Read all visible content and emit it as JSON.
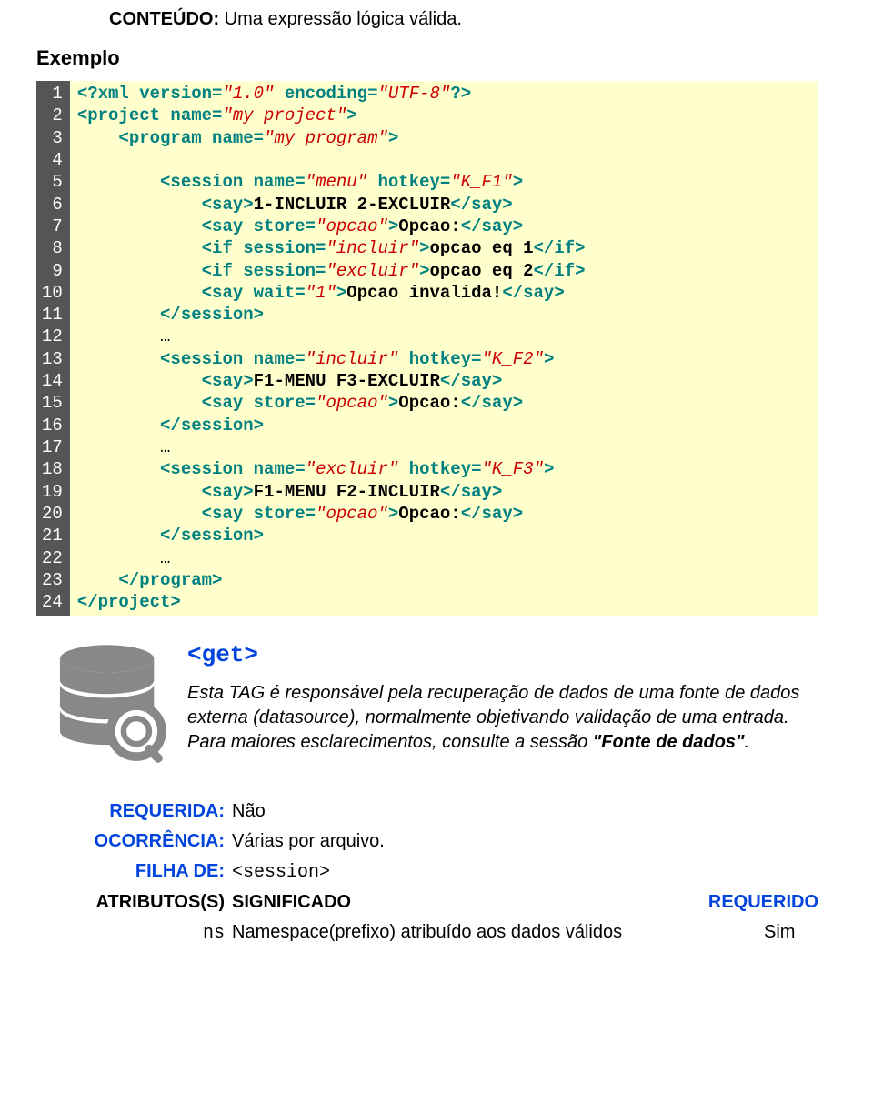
{
  "content": {
    "label": "CONTEÚDO:",
    "text": "Uma expressão lógica válida."
  },
  "example_header": "Exemplo",
  "code": {
    "line_count": 24,
    "lines": [
      [
        {
          "t": "tag",
          "v": "<?xml version="
        },
        {
          "t": "val",
          "v": "\"1.0\""
        },
        {
          "t": "tag",
          "v": " encoding="
        },
        {
          "t": "val",
          "v": "\"UTF-8\""
        },
        {
          "t": "tag",
          "v": "?>"
        }
      ],
      [
        {
          "t": "tag",
          "v": "<project name="
        },
        {
          "t": "val",
          "v": "\"my project\""
        },
        {
          "t": "tag",
          "v": ">"
        }
      ],
      [
        {
          "t": "pad",
          "v": "    "
        },
        {
          "t": "tag",
          "v": "<program name="
        },
        {
          "t": "val",
          "v": "\"my program\""
        },
        {
          "t": "tag",
          "v": ">"
        }
      ],
      [
        {
          "t": "pad",
          "v": ""
        }
      ],
      [
        {
          "t": "pad",
          "v": "        "
        },
        {
          "t": "tag",
          "v": "<session name="
        },
        {
          "t": "val",
          "v": "\"menu\""
        },
        {
          "t": "tag",
          "v": " hotkey="
        },
        {
          "t": "val",
          "v": "\"K_F1\""
        },
        {
          "t": "tag",
          "v": ">"
        }
      ],
      [
        {
          "t": "pad",
          "v": "            "
        },
        {
          "t": "tag",
          "v": "<say>"
        },
        {
          "t": "txt",
          "v": "1-INCLUIR 2-EXCLUIR"
        },
        {
          "t": "tag",
          "v": "</say>"
        }
      ],
      [
        {
          "t": "pad",
          "v": "            "
        },
        {
          "t": "tag",
          "v": "<say store="
        },
        {
          "t": "val",
          "v": "\"opcao\""
        },
        {
          "t": "tag",
          "v": ">"
        },
        {
          "t": "txt",
          "v": "Opcao:"
        },
        {
          "t": "tag",
          "v": "</say>"
        }
      ],
      [
        {
          "t": "pad",
          "v": "            "
        },
        {
          "t": "tag",
          "v": "<if session="
        },
        {
          "t": "val",
          "v": "\"incluir\""
        },
        {
          "t": "tag",
          "v": ">"
        },
        {
          "t": "txt",
          "v": "opcao eq 1"
        },
        {
          "t": "tag",
          "v": "</if>"
        }
      ],
      [
        {
          "t": "pad",
          "v": "            "
        },
        {
          "t": "tag",
          "v": "<if session="
        },
        {
          "t": "val",
          "v": "\"excluir\""
        },
        {
          "t": "tag",
          "v": ">"
        },
        {
          "t": "txt",
          "v": "opcao eq 2"
        },
        {
          "t": "tag",
          "v": "</if>"
        }
      ],
      [
        {
          "t": "pad",
          "v": "            "
        },
        {
          "t": "tag",
          "v": "<say wait="
        },
        {
          "t": "val",
          "v": "\"1\""
        },
        {
          "t": "tag",
          "v": ">"
        },
        {
          "t": "txt",
          "v": "Opcao invalida!"
        },
        {
          "t": "tag",
          "v": "</say>"
        }
      ],
      [
        {
          "t": "pad",
          "v": "        "
        },
        {
          "t": "tag",
          "v": "</session>"
        }
      ],
      [
        {
          "t": "pad",
          "v": "        "
        },
        {
          "t": "ell",
          "v": "…"
        }
      ],
      [
        {
          "t": "pad",
          "v": "        "
        },
        {
          "t": "tag",
          "v": "<session name="
        },
        {
          "t": "val",
          "v": "\"incluir\""
        },
        {
          "t": "tag",
          "v": " hotkey="
        },
        {
          "t": "val",
          "v": "\"K_F2\""
        },
        {
          "t": "tag",
          "v": ">"
        }
      ],
      [
        {
          "t": "pad",
          "v": "            "
        },
        {
          "t": "tag",
          "v": "<say>"
        },
        {
          "t": "txt",
          "v": "F1-MENU F3-EXCLUIR"
        },
        {
          "t": "tag",
          "v": "</say>"
        }
      ],
      [
        {
          "t": "pad",
          "v": "            "
        },
        {
          "t": "tag",
          "v": "<say store="
        },
        {
          "t": "val",
          "v": "\"opcao\""
        },
        {
          "t": "tag",
          "v": ">"
        },
        {
          "t": "txt",
          "v": "Opcao:"
        },
        {
          "t": "tag",
          "v": "</say>"
        }
      ],
      [
        {
          "t": "pad",
          "v": "        "
        },
        {
          "t": "tag",
          "v": "</session>"
        }
      ],
      [
        {
          "t": "pad",
          "v": "        "
        },
        {
          "t": "ell",
          "v": "…"
        }
      ],
      [
        {
          "t": "pad",
          "v": "        "
        },
        {
          "t": "tag",
          "v": "<session name="
        },
        {
          "t": "val",
          "v": "\"excluir\""
        },
        {
          "t": "tag",
          "v": " hotkey="
        },
        {
          "t": "val",
          "v": "\"K_F3\""
        },
        {
          "t": "tag",
          "v": ">"
        }
      ],
      [
        {
          "t": "pad",
          "v": "            "
        },
        {
          "t": "tag",
          "v": "<say>"
        },
        {
          "t": "txt",
          "v": "F1-MENU F2-INCLUIR"
        },
        {
          "t": "tag",
          "v": "</say>"
        }
      ],
      [
        {
          "t": "pad",
          "v": "            "
        },
        {
          "t": "tag",
          "v": "<say store="
        },
        {
          "t": "val",
          "v": "\"opcao\""
        },
        {
          "t": "tag",
          "v": ">"
        },
        {
          "t": "txt",
          "v": "Opcao:"
        },
        {
          "t": "tag",
          "v": "</say>"
        }
      ],
      [
        {
          "t": "pad",
          "v": "        "
        },
        {
          "t": "tag",
          "v": "</session>"
        }
      ],
      [
        {
          "t": "pad",
          "v": "        "
        },
        {
          "t": "ell",
          "v": "…"
        }
      ],
      [
        {
          "t": "pad",
          "v": "    "
        },
        {
          "t": "tag",
          "v": "</program>"
        }
      ],
      [
        {
          "t": "tag",
          "v": "</project>"
        }
      ]
    ]
  },
  "get_section": {
    "heading": "<get>",
    "desc_parts": [
      {
        "t": "n",
        "v": "Esta TAG é responsável pela recuperação de dados de uma fonte de dados externa (datasource), normalmente objetivando validação de uma entrada. Para maiores esclarecimentos, consulte a sessão "
      },
      {
        "t": "b",
        "v": "\"Fonte de dados\""
      },
      {
        "t": "n",
        "v": "."
      }
    ]
  },
  "meta": {
    "requerida": {
      "label": "REQUERIDA:",
      "value": "Não"
    },
    "ocorrencia": {
      "label": "OCORRÊNCIA:",
      "value": "Várias por arquivo."
    },
    "filha": {
      "label": "FILHA DE:",
      "value": "<session>"
    },
    "attr_header": {
      "label": "ATRIBUTOS(S)",
      "sig": "SIGNIFICADO",
      "req": "REQUERIDO"
    },
    "attr_row": {
      "ns": "ns",
      "desc": "Namespace(prefixo) atribuído aos dados válidos",
      "yes": "Sim"
    }
  }
}
